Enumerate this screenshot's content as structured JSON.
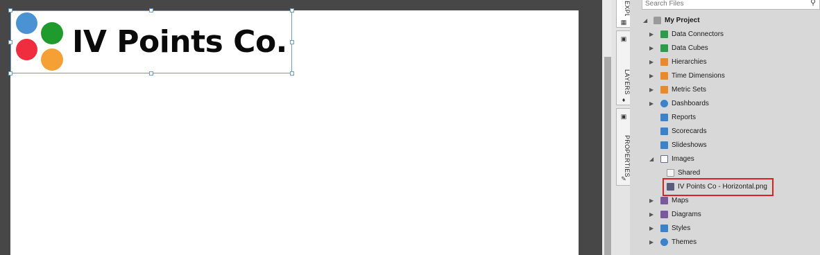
{
  "canvas": {
    "logo_text": "IV Points Co.",
    "logo_colors": {
      "blue": "#4b92d2",
      "green": "#1f9a2c",
      "red": "#ef2d3f",
      "orange": "#f5a035"
    }
  },
  "side_tabs": {
    "explorer_label": "EXPLORER",
    "layers_label": "LAYERS",
    "properties_label": "PROPERTIES"
  },
  "explorer": {
    "search_placeholder": "Search Files",
    "project": "My Project",
    "items": [
      {
        "label": "Data Connectors",
        "icon": "data-connector-icon",
        "color": "#2e9a4c",
        "expandable": true
      },
      {
        "label": "Data Cubes",
        "icon": "data-cube-icon",
        "color": "#2e9a4c",
        "expandable": true
      },
      {
        "label": "Hierarchies",
        "icon": "hierarchy-icon",
        "color": "#e88a2a",
        "expandable": true
      },
      {
        "label": "Time Dimensions",
        "icon": "time-dimension-icon",
        "color": "#e88a2a",
        "expandable": true
      },
      {
        "label": "Metric Sets",
        "icon": "metric-set-icon",
        "color": "#e88a2a",
        "expandable": true
      },
      {
        "label": "Dashboards",
        "icon": "dashboard-icon",
        "color": "#3b82c9",
        "expandable": true
      },
      {
        "label": "Reports",
        "icon": "report-icon",
        "color": "#3b82c9",
        "expandable": false
      },
      {
        "label": "Scorecards",
        "icon": "scorecard-icon",
        "color": "#3b82c9",
        "expandable": false
      },
      {
        "label": "Slideshows",
        "icon": "slideshow-icon",
        "color": "#3b82c9",
        "expandable": false
      },
      {
        "label": "Images",
        "icon": "images-icon",
        "color": "#6a6a8a",
        "expanded": true
      },
      {
        "label": "Shared",
        "icon": "folder-icon",
        "color": "#bcbcbc",
        "child": true
      },
      {
        "label": "IV Points Co - Horizontal.png",
        "icon": "image-file-icon",
        "color": "#5a5a7a",
        "child": true,
        "highlighted": true
      },
      {
        "label": "Maps",
        "icon": "map-icon",
        "color": "#7a5a9a",
        "expandable": true
      },
      {
        "label": "Diagrams",
        "icon": "diagram-icon",
        "color": "#7a5a9a",
        "expandable": true
      },
      {
        "label": "Styles",
        "icon": "style-icon",
        "color": "#3b82c9",
        "expandable": true
      },
      {
        "label": "Themes",
        "icon": "theme-icon",
        "color": "#3b82c9",
        "expandable": true
      }
    ]
  },
  "colors": {
    "highlight": "#e02020",
    "selection": "#6d9dc5"
  }
}
